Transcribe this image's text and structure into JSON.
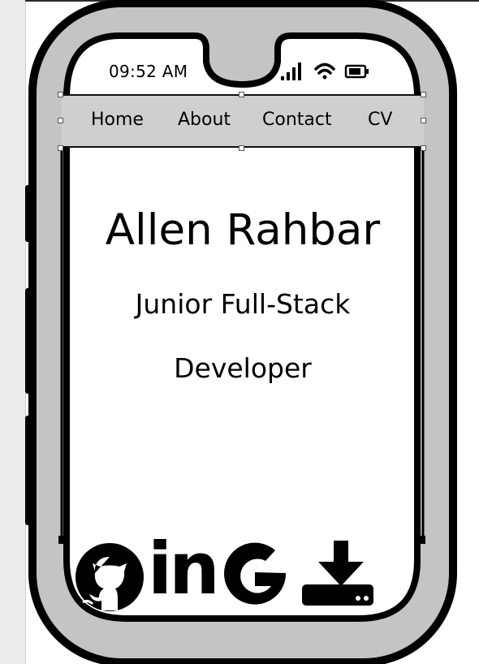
{
  "status_bar": {
    "time": "09:52 AM"
  },
  "nav": {
    "items": [
      {
        "label": "Home"
      },
      {
        "label": "About"
      },
      {
        "label": "Contact"
      },
      {
        "label": "CV"
      }
    ]
  },
  "hero": {
    "name": "Allen Rahbar",
    "role_line1": "Junior Full-Stack",
    "role_line2": "Developer"
  },
  "social": {
    "linkedin_text": "in",
    "icons": [
      "github-icon",
      "linkedin-icon",
      "google-icon",
      "download-icon"
    ]
  },
  "colors": {
    "phone_frame": "#c4c4c4",
    "outline": "#000000",
    "nav_bg": "#cfcfcf",
    "screen_bg": "#ffffff"
  }
}
